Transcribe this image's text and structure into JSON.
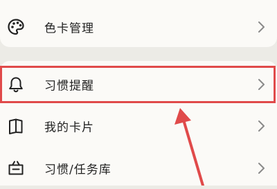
{
  "menu": {
    "items": [
      {
        "label": "色卡管理",
        "icon": "palette-icon"
      },
      {
        "label": "习惯提醒",
        "icon": "bell-icon"
      },
      {
        "label": "我的卡片",
        "icon": "book-icon"
      },
      {
        "label": "习惯/任务库",
        "icon": "basket-icon"
      }
    ]
  },
  "annotation": {
    "highlight_color": "#e04a4a",
    "highlighted_item": "习惯提醒"
  },
  "colors": {
    "background": "#ecebe6",
    "card": "#fbfaf7",
    "text": "#222222",
    "chevron": "#8a8a8a"
  }
}
